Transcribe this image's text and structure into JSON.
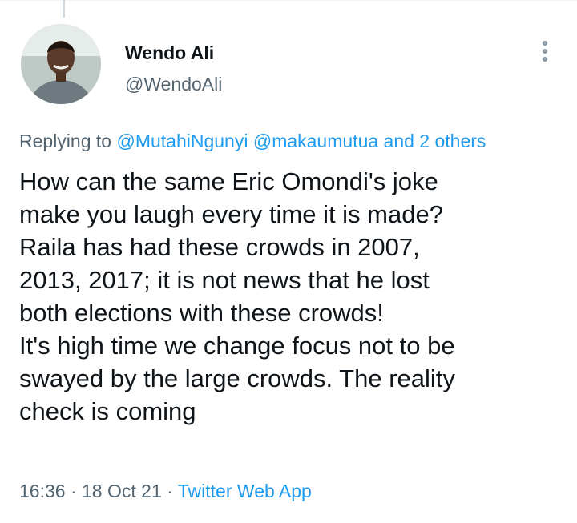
{
  "tweet": {
    "display_name": "Wendo Ali",
    "handle": "@WendoAli",
    "replying_prefix": "Replying to ",
    "replying_to": [
      "@MutahiNgunyi",
      "@makaumutua",
      "and 2 others"
    ],
    "text_lines": [
      "How can the same Eric Omondi's joke",
      "make you laugh every time it is made?",
      "Raila has had these crowds in 2007,",
      "2013, 2017; it is not news that he lost",
      "both elections with these crowds!",
      "It's high time we change focus not to be",
      "swayed by the large crowds. The reality",
      "check is coming"
    ],
    "time": "16:36",
    "date": "18 Oct 21",
    "source": "Twitter Web App",
    "separator": " · "
  },
  "icons": {
    "more": "more-vertical-icon",
    "avatar": "avatar-photo"
  },
  "colors": {
    "link": "#1d9bf0",
    "secondary_text": "#536471",
    "primary_text": "#0f1419"
  }
}
